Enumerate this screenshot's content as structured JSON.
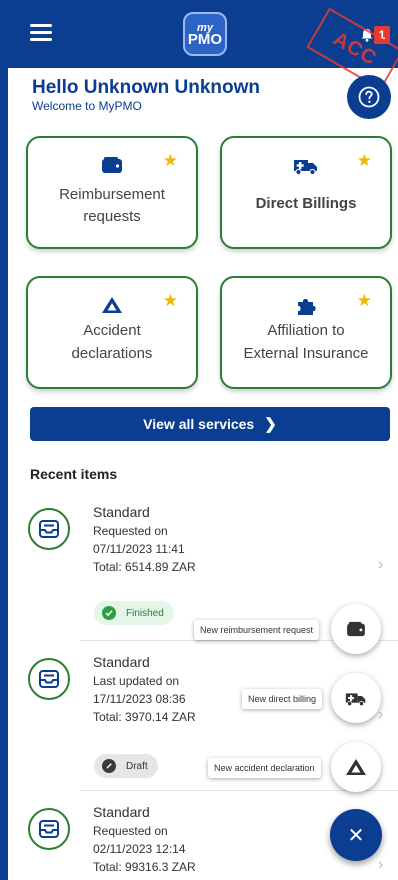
{
  "header": {
    "logo_line1": "my",
    "logo_line2": "PMO",
    "notification_count": "1",
    "env_stamp": "ACC"
  },
  "greeting": {
    "title": "Hello Unknown Unknown",
    "subtitle": "Welcome to MyPMO"
  },
  "services": [
    {
      "label_line1": "Reimbursement",
      "label_line2": "requests",
      "icon": "wallet-icon",
      "favorite": true
    },
    {
      "label_line1": "Direct Billings",
      "label_line2": "",
      "icon": "ambulance-icon",
      "favorite": true
    },
    {
      "label_line1": "Accident",
      "label_line2": "declarations",
      "icon": "warning-triangle-icon",
      "favorite": true
    },
    {
      "label_line1": "Affiliation to",
      "label_line2": "External Insurance",
      "icon": "puzzle-icon",
      "favorite": true
    }
  ],
  "view_all_label": "View all services",
  "recent": {
    "title": "Recent items",
    "items": [
      {
        "type": "Standard",
        "line1": "Requested on",
        "line2": "07/11/2023 11:41",
        "line3": "Total: 6514.89 ZAR",
        "status": "Finished"
      },
      {
        "type": "Standard",
        "line1": "Last updated on",
        "line2": "17/11/2023 08:36",
        "line3": "Total: 3970.14 ZAR",
        "status": "Draft"
      },
      {
        "type": "Standard",
        "line1": "Requested on",
        "line2": "02/11/2023 12:14",
        "line3": "Total: 99316.3 ZAR",
        "status": ""
      }
    ]
  },
  "fab": {
    "actions": [
      {
        "label": "New reimbursement request",
        "icon": "wallet-icon"
      },
      {
        "label": "New direct billing",
        "icon": "ambulance-icon"
      },
      {
        "label": "New accident declaration",
        "icon": "warning-triangle-icon"
      }
    ],
    "close_icon": "close-icon"
  },
  "colors": {
    "primary": "#0b3d91",
    "card_border": "#2e7d32",
    "star": "#f2b705",
    "badge": "#e53935"
  }
}
